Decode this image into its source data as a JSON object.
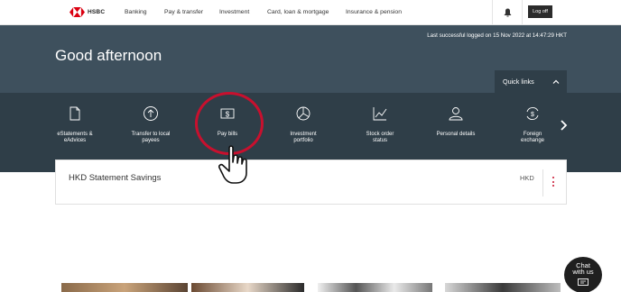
{
  "brand": {
    "name": "HSBC",
    "color": "#db0011"
  },
  "nav": {
    "items": [
      "Banking",
      "Pay & transfer",
      "Investment",
      "Card, loan & mortgage",
      "Insurance & pension"
    ],
    "logoff_label": "Log off"
  },
  "hero": {
    "last_logged": "Last successful logged on 15 Nov 2022 at 14:47:29 HKT",
    "greeting": "Good afternoon",
    "quick_links_label": "Quick links"
  },
  "quick_links": [
    {
      "label_line1": "eStatements &",
      "label_line2": "eAdvices",
      "icon": "document-icon"
    },
    {
      "label_line1": "Transfer to local",
      "label_line2": "payees",
      "icon": "arrow-up-circle-icon"
    },
    {
      "label_line1": "Pay bills",
      "label_line2": "",
      "icon": "dollar-bill-icon"
    },
    {
      "label_line1": "Investment",
      "label_line2": "portfolio",
      "icon": "pie-chart-icon"
    },
    {
      "label_line1": "Stock order",
      "label_line2": "status",
      "icon": "line-chart-icon"
    },
    {
      "label_line1": "Personal details",
      "label_line2": "",
      "icon": "person-icon"
    },
    {
      "label_line1": "Foreign",
      "label_line2": "exchange",
      "icon": "currency-exchange-icon"
    }
  ],
  "account": {
    "name": "HKD Statement Savings",
    "currency": "HKD"
  },
  "chat": {
    "line1": "Chat",
    "line2": "with us"
  },
  "colors": {
    "hero_bg": "#3e505d",
    "band_bg": "#2f3e48",
    "highlight": "#c8102e"
  }
}
